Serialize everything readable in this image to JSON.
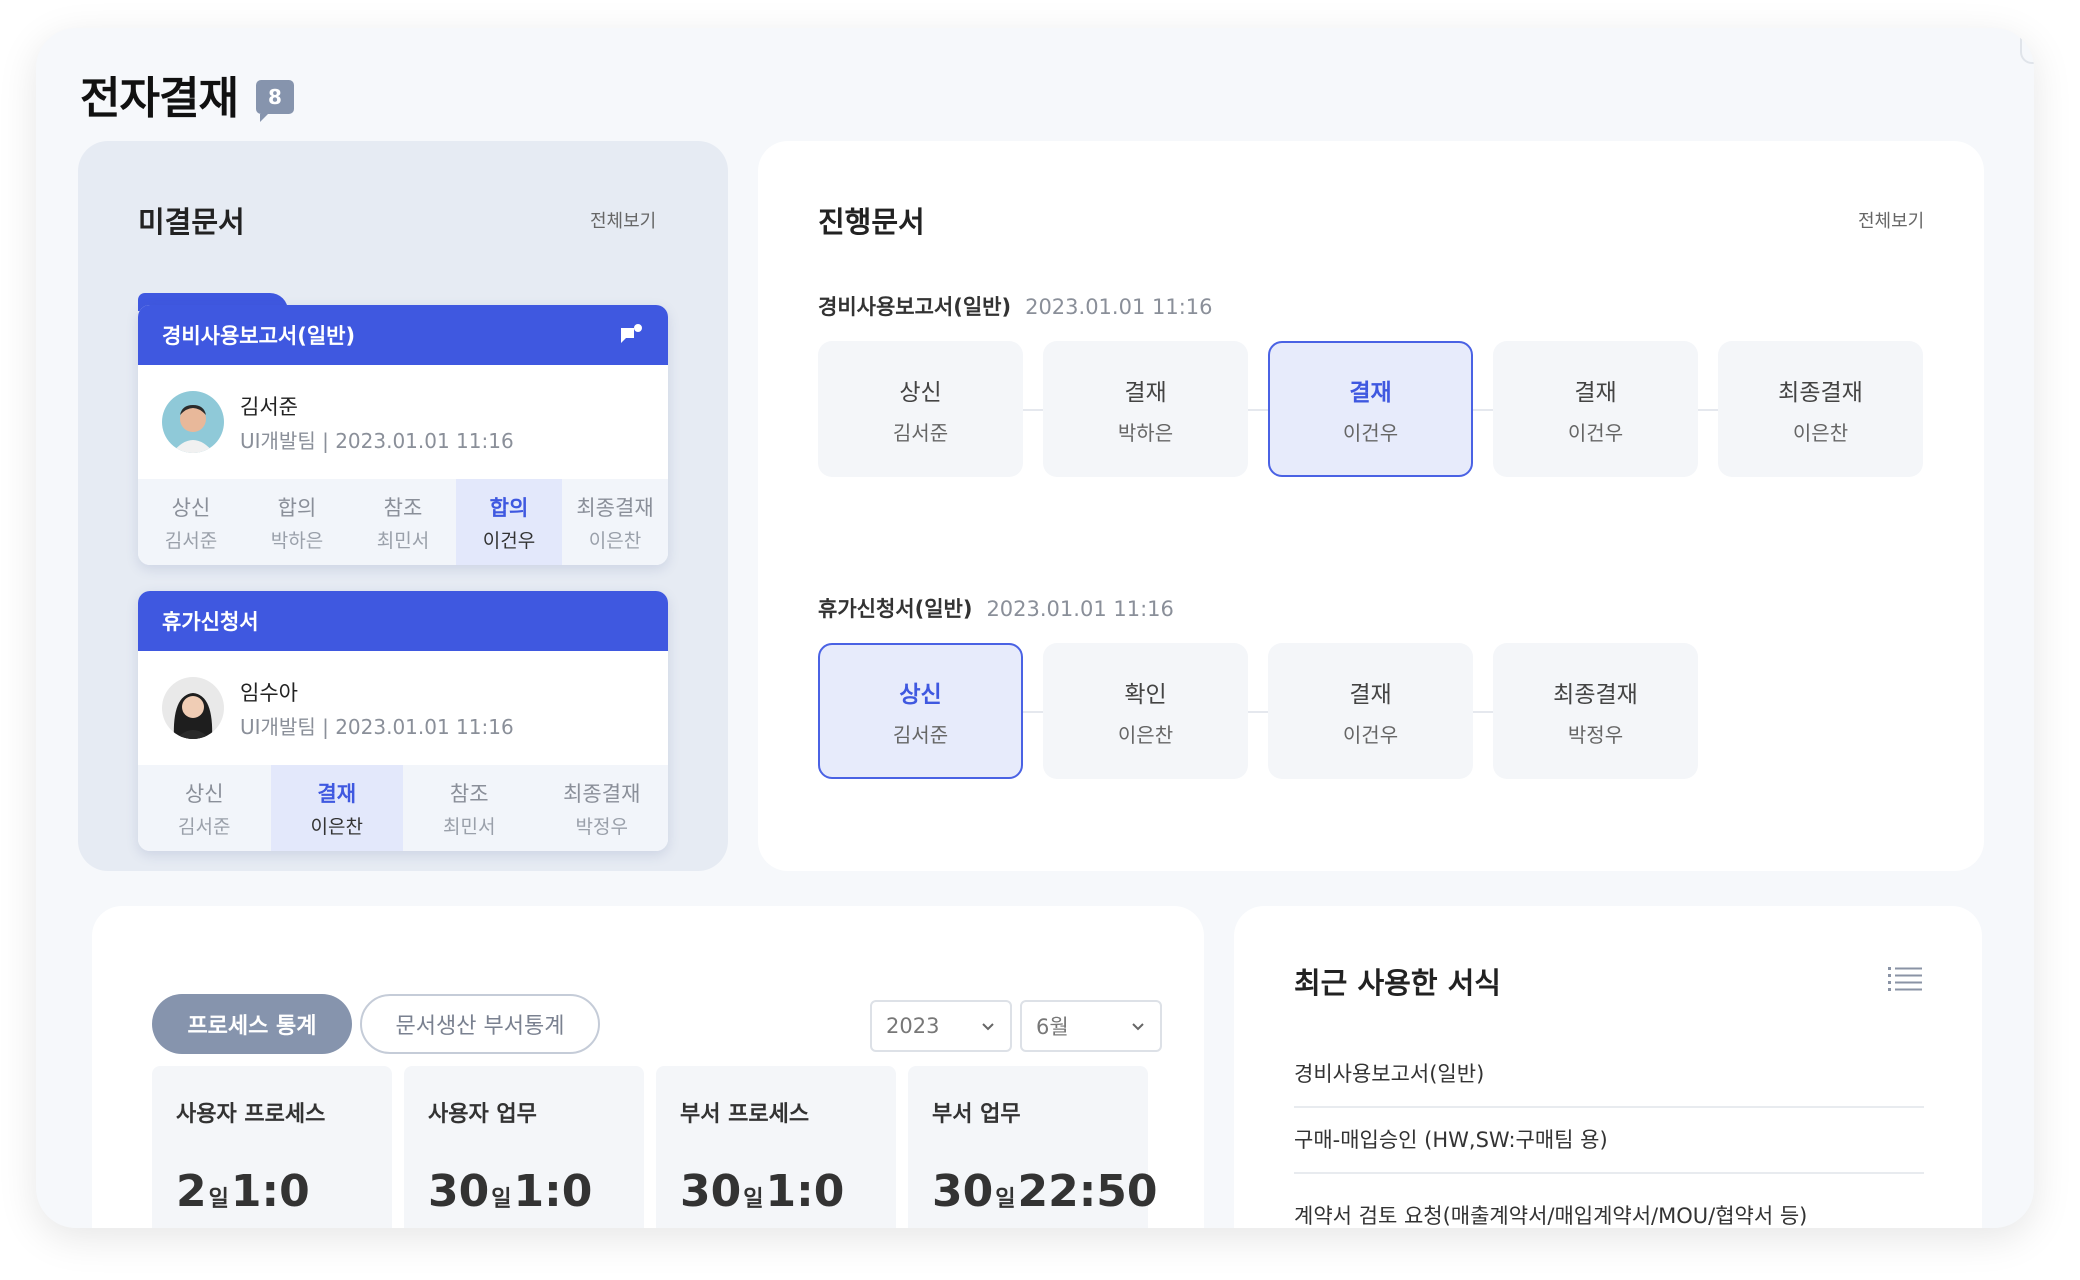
{
  "header": {
    "title": "전자결재",
    "badge": "8"
  },
  "pending": {
    "title": "미결문서",
    "view_all": "전체보기",
    "docs": [
      {
        "title": "경비사용보고서(일반)",
        "user": {
          "name": "김서준",
          "meta": "UI개발팀 | 2023.01.01 11:16"
        },
        "steps": [
          {
            "role": "상신",
            "name": "김서준"
          },
          {
            "role": "합의",
            "name": "박하은"
          },
          {
            "role": "참조",
            "name": "최민서"
          },
          {
            "role": "합의",
            "name": "이건우",
            "active": true
          },
          {
            "role": "최종결재",
            "name": "이은찬"
          }
        ]
      },
      {
        "title": "휴가신청서",
        "user": {
          "name": "임수아",
          "meta": "UI개발팀 | 2023.01.01 11:16"
        },
        "steps": [
          {
            "role": "상신",
            "name": "김서준"
          },
          {
            "role": "결재",
            "name": "이은찬",
            "active": true
          },
          {
            "role": "참조",
            "name": "최민서"
          },
          {
            "role": "최종결재",
            "name": "박정우"
          }
        ]
      }
    ]
  },
  "progress": {
    "title": "진행문서",
    "view_all": "전체보기",
    "flows": [
      {
        "title": "경비사용보고서(일반)",
        "time": "2023.01.01 11:16",
        "steps": [
          {
            "role": "상신",
            "name": "김서준"
          },
          {
            "role": "결재",
            "name": "박하은"
          },
          {
            "role": "결재",
            "name": "이건우",
            "active": true
          },
          {
            "role": "결재",
            "name": "이건우"
          },
          {
            "role": "최종결재",
            "name": "이은찬"
          }
        ]
      },
      {
        "title": "휴가신청서(일반)",
        "time": "2023.01.01 11:16",
        "steps": [
          {
            "role": "상신",
            "name": "김서준",
            "active": true
          },
          {
            "role": "확인",
            "name": "이은찬"
          },
          {
            "role": "결재",
            "name": "이건우"
          },
          {
            "role": "최종결재",
            "name": "박정우"
          }
        ]
      }
    ]
  },
  "stats": {
    "tabs": [
      "프로세스 통계",
      "문서생산 부서통계"
    ],
    "year": "2023",
    "month": "6월",
    "day_unit": "일",
    "cards": [
      {
        "label": "사용자 프로세스",
        "days": "2",
        "time": "1:0"
      },
      {
        "label": "사용자 업무",
        "days": "30",
        "time": "1:0"
      },
      {
        "label": "부서 프로세스",
        "days": "30",
        "time": "1:0"
      },
      {
        "label": "부서 업무",
        "days": "30",
        "time": "22:50"
      }
    ]
  },
  "recent": {
    "title": "최근 사용한 서식",
    "items": [
      "경비사용보고서(일반)",
      "구매-매입승인 (HW,SW:구매팀 용)",
      "계약서 검토 요청(매출계약서/매입계약서/MOU/협약서 등)"
    ]
  },
  "colors": {
    "accent": "#3f58e0",
    "accent_light": "#e7ebfb",
    "muted_pill": "#8694ad",
    "panel_bg": "#e6ebf3"
  },
  "icons": [
    "message-icon",
    "chevron-down-icon",
    "list-icon",
    "avatar-male",
    "avatar-female"
  ]
}
